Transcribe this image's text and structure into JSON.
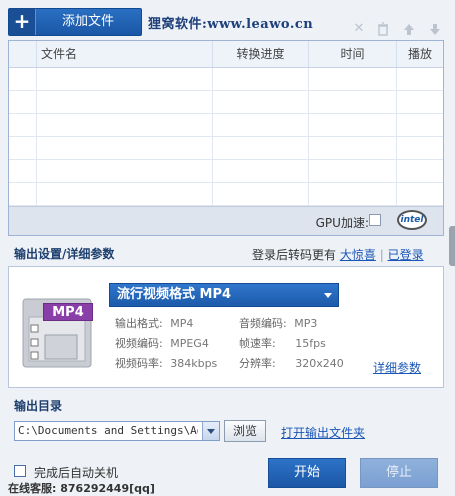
{
  "toolbar": {
    "add_file_label": "添加文件",
    "brand_text": "狸窝软件:www.leawo.cn",
    "icons": [
      "close-icon",
      "delete-icon",
      "move-up-icon",
      "move-down-icon"
    ]
  },
  "file_table": {
    "columns": [
      "文件名",
      "转换进度",
      "时间",
      "播放"
    ],
    "rows": [
      [],
      [],
      [],
      [],
      [],
      [],
      []
    ],
    "gpu_label": "GPU加速:",
    "gpu_enabled": false,
    "intel_logo": "intel"
  },
  "output_settings": {
    "title": "输出设置/详细参数",
    "login_prompt": "登录后转码更有",
    "surprise_link": "大惊喜",
    "logged_in_link": "已登录",
    "icon_label": "MP4",
    "format_selected": "流行视频格式 MP4",
    "properties": {
      "output_format_label": "输出格式:",
      "output_format_value": "MP4",
      "audio_codec_label": "音频编码:",
      "audio_codec_value": "MP3",
      "video_codec_label": "视频编码:",
      "video_codec_value": "MPEG4",
      "frame_rate_label": "帧速率:",
      "frame_rate_value": "15fps",
      "video_bitrate_label": "视频码率:",
      "video_bitrate_value": "384kbps",
      "resolution_label": "分辨率:",
      "resolution_value": "320x240"
    },
    "detail_link": "详细参数"
  },
  "output_dir": {
    "title": "输出目录",
    "path": "C:\\Documents and Settings\\Admir",
    "browse_label": "浏览",
    "open_folder_link": "打开输出文件夹"
  },
  "footer": {
    "shutdown_label": "完成后自动关机",
    "shutdown_checked": false,
    "contact": "在线客服: 876292449[qq]",
    "start_label": "开始",
    "stop_label": "停止"
  },
  "colors": {
    "accent": "#1b57a6",
    "link": "#1a56b6",
    "window_bg": "#eef1f6",
    "mp4_badge": "#8a3fa8"
  }
}
